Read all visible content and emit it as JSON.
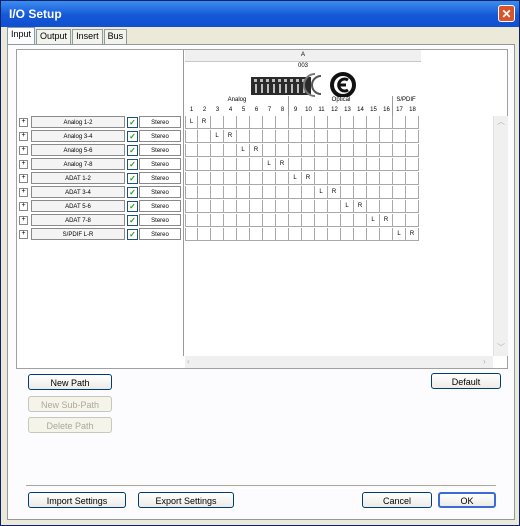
{
  "window": {
    "title": "I/O Setup",
    "close_symbol": "✕"
  },
  "tabs": [
    {
      "label": "Input",
      "active": true
    },
    {
      "label": "Output",
      "active": false
    },
    {
      "label": "Insert",
      "active": false
    },
    {
      "label": "Bus",
      "active": false
    }
  ],
  "matrix": {
    "interface_label": "A",
    "device_name": "003",
    "groups": [
      {
        "label": "Analog",
        "start": 1,
        "end": 8
      },
      {
        "label": "Optical",
        "start": 9,
        "end": 16
      },
      {
        "label": "S/PDIF",
        "start": 17,
        "end": 18
      }
    ],
    "channels": [
      "1",
      "2",
      "3",
      "4",
      "5",
      "6",
      "7",
      "8",
      "9",
      "10",
      "11",
      "12",
      "13",
      "14",
      "15",
      "16",
      "17",
      "18"
    ],
    "left_symbol": "L",
    "right_symbol": "R"
  },
  "paths": [
    {
      "name": "Analog 1-2",
      "format": "Stereo",
      "checked": true,
      "left_channel": 1,
      "right_channel": 2
    },
    {
      "name": "Analog 3-4",
      "format": "Stereo",
      "checked": true,
      "left_channel": 3,
      "right_channel": 4
    },
    {
      "name": "Analog 5-6",
      "format": "Stereo",
      "checked": true,
      "left_channel": 5,
      "right_channel": 6
    },
    {
      "name": "Analog 7-8",
      "format": "Stereo",
      "checked": true,
      "left_channel": 7,
      "right_channel": 8
    },
    {
      "name": "ADAT 1-2",
      "format": "Stereo",
      "checked": true,
      "left_channel": 9,
      "right_channel": 10
    },
    {
      "name": "ADAT 3-4",
      "format": "Stereo",
      "checked": true,
      "left_channel": 11,
      "right_channel": 12
    },
    {
      "name": "ADAT 5-6",
      "format": "Stereo",
      "checked": true,
      "left_channel": 13,
      "right_channel": 14
    },
    {
      "name": "ADAT 7-8",
      "format": "Stereo",
      "checked": true,
      "left_channel": 15,
      "right_channel": 16
    },
    {
      "name": "S/PDIF L-R",
      "format": "Stereo",
      "checked": true,
      "left_channel": 17,
      "right_channel": 18
    }
  ],
  "buttons": {
    "new_path": "New Path",
    "new_sub_path": "New Sub-Path",
    "delete_path": "Delete Path",
    "default": "Default",
    "import_settings": "Import Settings",
    "export_settings": "Export Settings",
    "cancel": "Cancel",
    "ok": "OK"
  },
  "colors": {
    "titlebar": "#1458d8",
    "checkmark": "#21a121",
    "close": "#d8542c"
  }
}
